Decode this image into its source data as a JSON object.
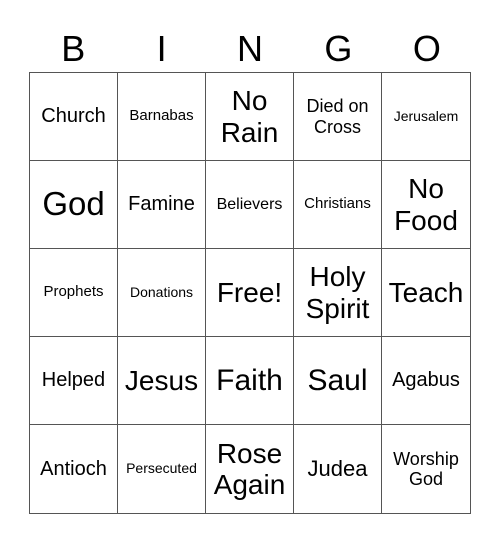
{
  "header": {
    "letters": [
      "B",
      "I",
      "N",
      "G",
      "O"
    ]
  },
  "cells": [
    {
      "text": "Church",
      "size": "s20"
    },
    {
      "text": "Barnabas",
      "size": "s15"
    },
    {
      "text": "No Rain",
      "size": "s28"
    },
    {
      "text": "Died on Cross",
      "size": "s18"
    },
    {
      "text": "Jerusalem",
      "size": "s14"
    },
    {
      "text": "God",
      "size": "s33"
    },
    {
      "text": "Famine",
      "size": "s20"
    },
    {
      "text": "Believers",
      "size": "s16"
    },
    {
      "text": "Christians",
      "size": "s15"
    },
    {
      "text": "No Food",
      "size": "s28"
    },
    {
      "text": "Prophets",
      "size": "s15"
    },
    {
      "text": "Donations",
      "size": "s14"
    },
    {
      "text": "Free!",
      "size": "s28"
    },
    {
      "text": "Holy Spirit",
      "size": "s28"
    },
    {
      "text": "Teach",
      "size": "s28"
    },
    {
      "text": "Helped",
      "size": "s20"
    },
    {
      "text": "Jesus",
      "size": "s28"
    },
    {
      "text": "Faith",
      "size": "s30"
    },
    {
      "text": "Saul",
      "size": "s30"
    },
    {
      "text": "Agabus",
      "size": "s20"
    },
    {
      "text": "Antioch",
      "size": "s20"
    },
    {
      "text": "Persecuted",
      "size": "s14"
    },
    {
      "text": "Rose Again",
      "size": "s28"
    },
    {
      "text": "Judea",
      "size": "s22"
    },
    {
      "text": "Worship God",
      "size": "s18"
    }
  ]
}
